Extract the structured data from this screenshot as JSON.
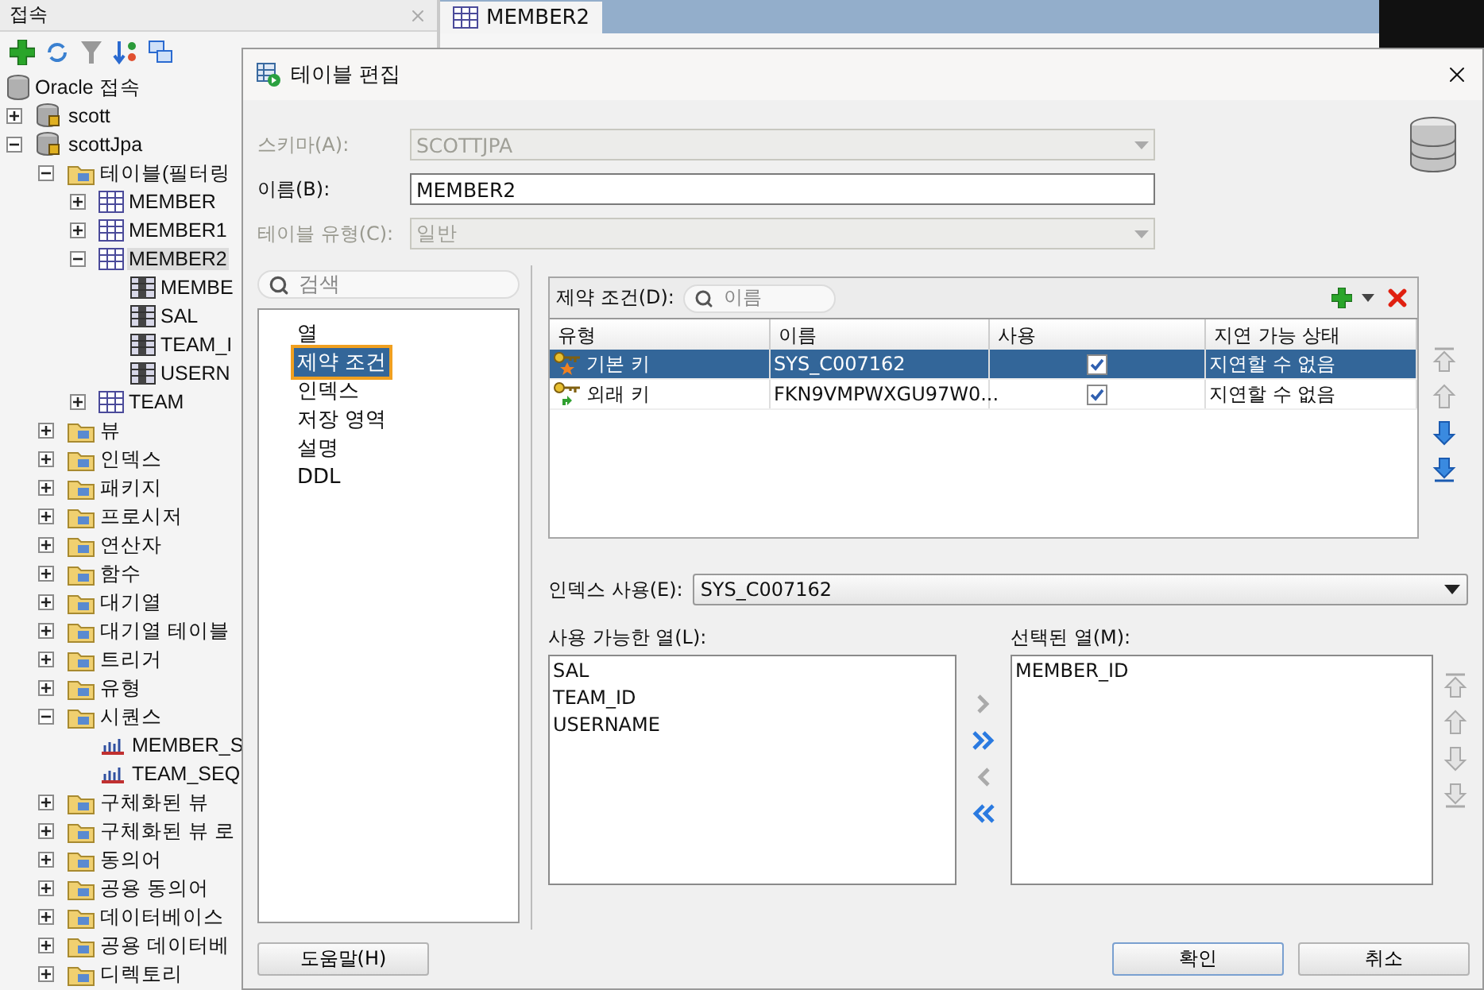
{
  "connections": {
    "title": "접속",
    "tree": [
      {
        "label": "Oracle 접속",
        "kind": "db",
        "selected": false,
        "children": [
          {
            "label": "scott",
            "kind": "conn",
            "expanded": false,
            "selected": false
          },
          {
            "label": "scottJpa",
            "kind": "conn",
            "expanded": true,
            "selected": false,
            "children": [
              {
                "label": "테이블(필터링",
                "kind": "folder",
                "expanded": true,
                "selected": false,
                "children": [
                  {
                    "label": "MEMBER",
                    "kind": "table",
                    "expanded": false,
                    "selected": false
                  },
                  {
                    "label": "MEMBER1",
                    "kind": "table",
                    "expanded": false,
                    "selected": false
                  },
                  {
                    "label": "MEMBER2",
                    "kind": "table",
                    "expanded": true,
                    "selected": true,
                    "children": [
                      {
                        "label": "MEMBE",
                        "kind": "column",
                        "selected": false
                      },
                      {
                        "label": "SAL",
                        "kind": "column",
                        "selected": false
                      },
                      {
                        "label": "TEAM_I",
                        "kind": "column",
                        "selected": false
                      },
                      {
                        "label": "USERN",
                        "kind": "column",
                        "selected": false
                      }
                    ]
                  },
                  {
                    "label": "TEAM",
                    "kind": "table",
                    "expanded": false,
                    "selected": false
                  }
                ]
              },
              {
                "label": "뷰",
                "kind": "folder",
                "expanded": false,
                "selected": false
              },
              {
                "label": "인덱스",
                "kind": "folder",
                "expanded": false,
                "selected": false
              },
              {
                "label": "패키지",
                "kind": "folder",
                "expanded": false,
                "selected": false
              },
              {
                "label": "프로시저",
                "kind": "folder",
                "expanded": false,
                "selected": false
              },
              {
                "label": "연산자",
                "kind": "folder",
                "expanded": false,
                "selected": false
              },
              {
                "label": "함수",
                "kind": "folder",
                "expanded": false,
                "selected": false
              },
              {
                "label": "대기열",
                "kind": "folder",
                "expanded": false,
                "selected": false
              },
              {
                "label": "대기열 테이블",
                "kind": "folder",
                "expanded": false,
                "selected": false
              },
              {
                "label": "트리거",
                "kind": "folder",
                "expanded": false,
                "selected": false
              },
              {
                "label": "유형",
                "kind": "folder",
                "expanded": false,
                "selected": false
              },
              {
                "label": "시퀀스",
                "kind": "folder",
                "expanded": true,
                "selected": false,
                "children": [
                  {
                    "label": "MEMBER_S",
                    "kind": "sequence",
                    "selected": false
                  },
                  {
                    "label": "TEAM_SEQ",
                    "kind": "sequence",
                    "selected": false
                  }
                ]
              },
              {
                "label": "구체화된 뷰",
                "kind": "folder",
                "expanded": false,
                "selected": false
              },
              {
                "label": "구체화된 뷰 로",
                "kind": "folder",
                "expanded": false,
                "selected": false
              },
              {
                "label": "동의어",
                "kind": "folder",
                "expanded": false,
                "selected": false
              },
              {
                "label": "공용 동의어",
                "kind": "folder",
                "expanded": false,
                "selected": false
              },
              {
                "label": "데이터베이스",
                "kind": "folder",
                "expanded": false,
                "selected": false
              },
              {
                "label": "공용 데이터베",
                "kind": "folder",
                "expanded": false,
                "selected": false
              },
              {
                "label": "디렉토리",
                "kind": "folder",
                "expanded": false,
                "selected": false
              }
            ]
          }
        ]
      }
    ]
  },
  "editor": {
    "tab": "MEMBER2"
  },
  "dialog": {
    "title": "테이블 편집",
    "fields": [
      {
        "label": "스키마(A):",
        "value": "SCOTTJPA",
        "kind": "combo",
        "disabled": true
      },
      {
        "label": "이름(B):",
        "value": "MEMBER2",
        "kind": "text",
        "disabled": false
      },
      {
        "label": "테이블 유형(C):",
        "value": "일반",
        "kind": "combo",
        "disabled": true
      }
    ],
    "nav_search": {
      "placeholder": "검색"
    },
    "nav": [
      {
        "label": "열",
        "selected": false
      },
      {
        "label": "제약 조건",
        "selected": true
      },
      {
        "label": "인덱스",
        "selected": false
      },
      {
        "label": "저장 영역",
        "selected": false
      },
      {
        "label": "설명",
        "selected": false
      },
      {
        "label": "DDL",
        "selected": false
      }
    ],
    "constraints": {
      "label": "제약 조건(D):",
      "search_placeholder": "이름",
      "columns": [
        "유형",
        "이름",
        "사용",
        "지연 가능 상태"
      ],
      "rows": [
        {
          "type": "기본 키",
          "kind": "primary",
          "name": "SYS_C007162",
          "enabled": true,
          "deferrable": "지연할 수 없음",
          "selected": true
        },
        {
          "type": "외래 키",
          "kind": "foreign",
          "name": "FKN9VMPWXGU97W0...",
          "enabled": true,
          "deferrable": "지연할 수 없음",
          "selected": false
        }
      ],
      "order_buttons": [
        {
          "kind": "top",
          "disabled": true
        },
        {
          "kind": "up",
          "disabled": true
        },
        {
          "kind": "down",
          "disabled": false
        },
        {
          "kind": "bottom",
          "disabled": false
        }
      ]
    },
    "index_use": {
      "label": "인덱스 사용(E):",
      "value": "SYS_C007162"
    },
    "available": {
      "label": "사용 가능한 열(L):",
      "items": [
        "SAL",
        "TEAM_ID",
        "USERNAME"
      ]
    },
    "chosen": {
      "label": "선택된 열(M):",
      "items": [
        "MEMBER_ID"
      ]
    },
    "move_buttons": [
      {
        "kind": "add",
        "disabled": true
      },
      {
        "kind": "add_all",
        "disabled": false
      },
      {
        "kind": "remove",
        "disabled": true
      },
      {
        "kind": "remove_all",
        "disabled": false
      }
    ],
    "chosen_order_buttons": [
      {
        "kind": "top",
        "disabled": true
      },
      {
        "kind": "up",
        "disabled": true
      },
      {
        "kind": "down",
        "disabled": true
      },
      {
        "kind": "bottom",
        "disabled": true
      }
    ],
    "buttons": [
      {
        "label": "도움말(H)",
        "kind": "help",
        "default": false
      },
      {
        "label": "확인",
        "kind": "ok",
        "default": true
      },
      {
        "label": "취소",
        "kind": "cancel",
        "default": false
      }
    ]
  }
}
